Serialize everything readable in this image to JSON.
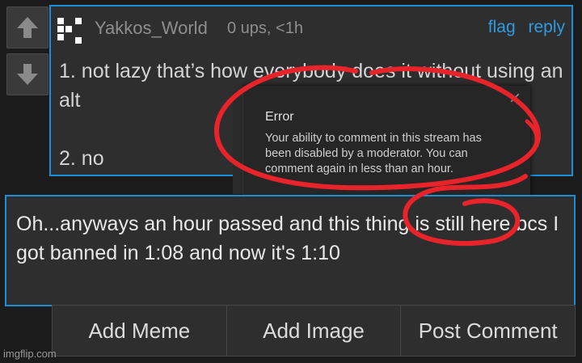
{
  "comment": {
    "username": "Yakkos_World",
    "meta": "0 ups, <1h",
    "flag_label": "flag",
    "reply_label": "reply",
    "text": "1. not lazy that’s how everybody does it without using an alt\n\n2. no"
  },
  "error_dialog": {
    "title": "Error",
    "message": "Your ability to comment in this stream has been disabled by a moderator. You can comment again in less than an hour.",
    "close_icon": "close-icon"
  },
  "composer": {
    "text": "Oh...anyways an hour passed and this thing is still here bcs I got banned in 1:08 and now it's 1:10"
  },
  "buttons": {
    "add_meme": "Add Meme",
    "add_image": "Add Image",
    "post_comment": "Post Comment"
  },
  "watermark": "imgflip.com",
  "colors": {
    "accent": "#1a8fd6",
    "annotation_red": "#e8242a"
  }
}
